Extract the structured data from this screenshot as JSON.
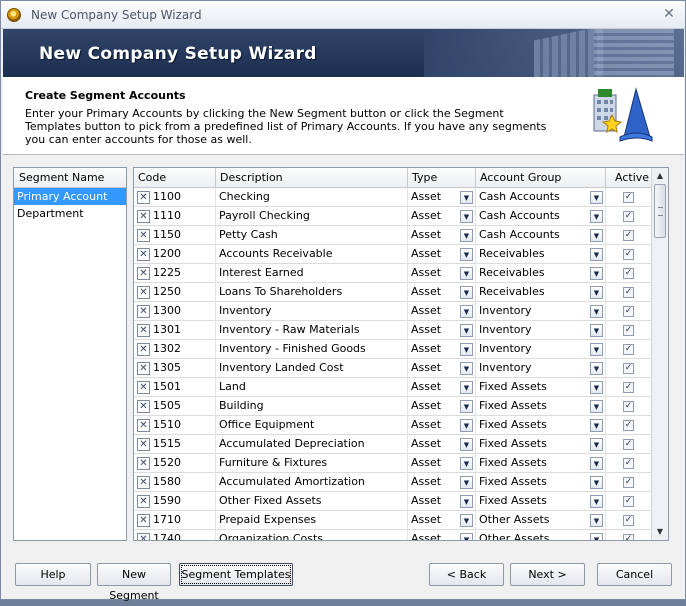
{
  "window": {
    "title": "New Company Setup Wizard"
  },
  "banner": {
    "title": "New Company Setup Wizard"
  },
  "header": {
    "heading": "Create Segment Accounts",
    "instructions": "Enter your Primary Accounts by clicking the New Segment button or click the Segment Templates button to pick from a predefined list of Primary Accounts. If you have any segments you can enter accounts for those as well."
  },
  "segments": {
    "header": "Segment Name",
    "items": [
      {
        "label": "Primary Account",
        "selected": true
      },
      {
        "label": "Department",
        "selected": false
      }
    ]
  },
  "grid": {
    "columns": {
      "code": "Code",
      "description": "Description",
      "type": "Type",
      "group": "Account Group",
      "active": "Active"
    },
    "rows": [
      {
        "code": "1100",
        "description": "Checking",
        "type": "Asset",
        "group": "Cash Accounts",
        "active": true
      },
      {
        "code": "1110",
        "description": "Payroll Checking",
        "type": "Asset",
        "group": "Cash Accounts",
        "active": true
      },
      {
        "code": "1150",
        "description": "Petty Cash",
        "type": "Asset",
        "group": "Cash Accounts",
        "active": true
      },
      {
        "code": "1200",
        "description": "Accounts Receivable",
        "type": "Asset",
        "group": "Receivables",
        "active": true
      },
      {
        "code": "1225",
        "description": "Interest Earned",
        "type": "Asset",
        "group": "Receivables",
        "active": true
      },
      {
        "code": "1250",
        "description": "Loans To Shareholders",
        "type": "Asset",
        "group": "Receivables",
        "active": true
      },
      {
        "code": "1300",
        "description": "Inventory",
        "type": "Asset",
        "group": "Inventory",
        "active": true
      },
      {
        "code": "1301",
        "description": "Inventory - Raw Materials",
        "type": "Asset",
        "group": "Inventory",
        "active": true
      },
      {
        "code": "1302",
        "description": "Inventory - Finished Goods",
        "type": "Asset",
        "group": "Inventory",
        "active": true
      },
      {
        "code": "1305",
        "description": "Inventory Landed Cost",
        "type": "Asset",
        "group": "Inventory",
        "active": true
      },
      {
        "code": "1501",
        "description": "Land",
        "type": "Asset",
        "group": "Fixed Assets",
        "active": true
      },
      {
        "code": "1505",
        "description": "Building",
        "type": "Asset",
        "group": "Fixed Assets",
        "active": true
      },
      {
        "code": "1510",
        "description": "Office Equipment",
        "type": "Asset",
        "group": "Fixed Assets",
        "active": true
      },
      {
        "code": "1515",
        "description": "Accumulated Depreciation",
        "type": "Asset",
        "group": "Fixed Assets",
        "active": true
      },
      {
        "code": "1520",
        "description": "Furniture & Fixtures",
        "type": "Asset",
        "group": "Fixed Assets",
        "active": true
      },
      {
        "code": "1580",
        "description": "Accumulated Amortization",
        "type": "Asset",
        "group": "Fixed Assets",
        "active": true
      },
      {
        "code": "1590",
        "description": "Other Fixed Assets",
        "type": "Asset",
        "group": "Fixed Assets",
        "active": true
      },
      {
        "code": "1710",
        "description": "Prepaid Expenses",
        "type": "Asset",
        "group": "Other Assets",
        "active": true
      },
      {
        "code": "1740",
        "description": "Organization Costs",
        "type": "Asset",
        "group": "Other Assets",
        "active": true
      }
    ]
  },
  "buttons": {
    "help": "Help",
    "new_segment": "New Segment",
    "segment_templates": "Segment Templates",
    "back": "< Back",
    "next": "Next >",
    "cancel": "Cancel"
  },
  "icons": {
    "app": "company-setup-icon",
    "close": "close-icon",
    "wizard": "building-wizard-icon",
    "remove_row": "delete-row-icon",
    "dropdown": "chevron-down-icon",
    "checkbox": "checkmark-icon"
  },
  "colors": {
    "banner": "#1d2e4f",
    "selection": "#3399ff"
  }
}
